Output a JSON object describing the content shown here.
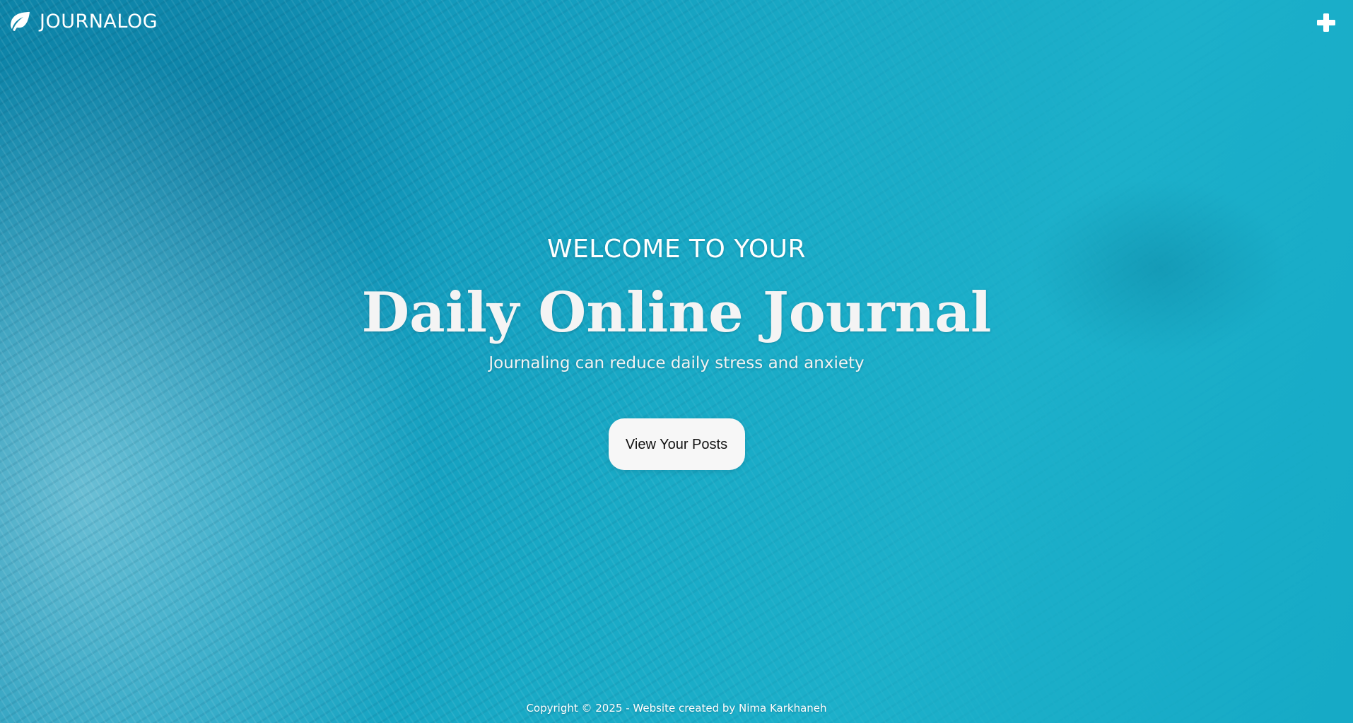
{
  "header": {
    "brand_name": "JOURNALOG",
    "brand_icon": "leaf-icon",
    "add_icon": "plus-icon"
  },
  "hero": {
    "welcome": "WELCOME TO YOUR",
    "title": "Daily Online Journal",
    "subtitle": "Journaling can reduce daily stress and anxiety",
    "cta_label": "View Your Posts"
  },
  "footer": {
    "copyright": "Copyright © 2025 - Website created by Nima Karkhaneh"
  },
  "colors": {
    "text": "#ffffff",
    "button_bg": "#f7f7f7",
    "button_text": "#111111",
    "background_accent": "#1aa6c2"
  }
}
